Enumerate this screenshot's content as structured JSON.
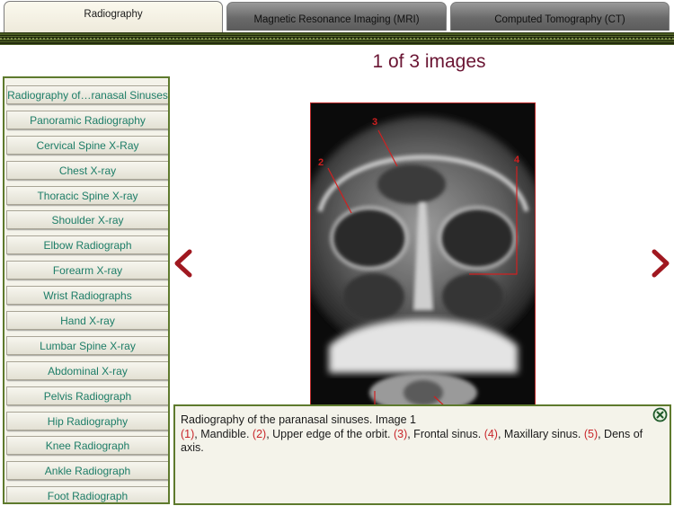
{
  "tabs": [
    {
      "label": "Radiography",
      "active": true
    },
    {
      "label": "Magnetic Resonance Imaging (MRI)",
      "active": false
    },
    {
      "label": "Computed Tomography (CT)",
      "active": false
    }
  ],
  "title": "1 of 3 images",
  "sidebar": {
    "items": [
      "Radiography of…ranasal Sinuses",
      "Panoramic Radiography",
      "Cervical Spine X-Ray",
      "Chest X-ray",
      "Thoracic Spine X-ray",
      "Shoulder X-ray",
      "Elbow Radiograph",
      "Forearm X-ray",
      "Wrist Radiographs",
      "Hand X-ray",
      "Lumbar Spine X-ray",
      "Abdominal X-ray",
      "Pelvis Radiograph",
      "Hip Radiography",
      "Knee Radiograph",
      "Ankle Radiograph",
      "Foot Radiograph"
    ]
  },
  "image": {
    "markers": [
      "2",
      "3",
      "4"
    ]
  },
  "caption": {
    "heading": "Radiography of the paranasal sinuses. Image 1",
    "parts": [
      {
        "num": "(1)",
        "text": ", Mandible.  "
      },
      {
        "num": "(2)",
        "text": ", Upper edge of the orbit.  "
      },
      {
        "num": "(3)",
        "text": ", Frontal sinus.  "
      },
      {
        "num": "(4)",
        "text": ", Maxillary sinus.  "
      },
      {
        "num": "(5)",
        "text": ", Dens of axis."
      }
    ]
  },
  "icons": {
    "prev": "chevron-left-icon",
    "next": "chevron-right-icon",
    "close": "close-circle-icon"
  },
  "colors": {
    "accent": "#6a1533",
    "frame": "#5e7a2d",
    "link": "#1d7d67",
    "marker": "#c8262b"
  }
}
